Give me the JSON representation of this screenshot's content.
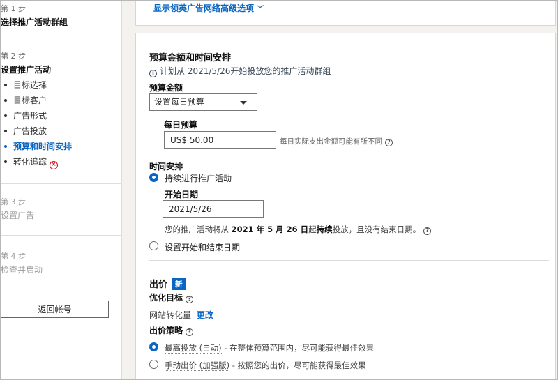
{
  "sidebar": {
    "step1": {
      "num": "第 1 步",
      "title": "选择推广活动群组"
    },
    "step2": {
      "num": "第 2 步",
      "title": "设置推广活动",
      "items": [
        {
          "label": "目标选择"
        },
        {
          "label": "目标客户"
        },
        {
          "label": "广告形式"
        },
        {
          "label": "广告投放"
        },
        {
          "label": "预算和时间安排"
        },
        {
          "label": "转化追踪"
        }
      ]
    },
    "step3": {
      "num": "第 3 步",
      "title": "设置广告"
    },
    "step4": {
      "num": "第 4 步",
      "title": "检查并启动"
    },
    "back_button": "返回帐号"
  },
  "top_card": {
    "advanced_link": "显示领英广告网络高级选项"
  },
  "budget": {
    "section_title": "预算金额和时间安排",
    "info_text": "计划从 2021/5/26开始投放您的推广活动群组",
    "amount_label": "预算金额",
    "budget_type": "设置每日预算",
    "daily_label": "每日预算",
    "daily_value": "US$ 50.00",
    "daily_hint": "每日实际支出金额可能有所不同",
    "schedule_label": "时间安排",
    "option_continuous": "持续进行推广活动",
    "start_label": "开始日期",
    "start_value": "2021/5/26",
    "desc_prefix": "您的推广活动将从",
    "desc_date": "2021 年 5 月 26 日",
    "desc_mid": "起",
    "desc_bold": "持续",
    "desc_suffix": "投放，且没有结束日期。",
    "option_start_end": "设置开始和结束日期"
  },
  "bidding": {
    "title": "出价",
    "badge": "新",
    "goal_label": "优化目标",
    "goal_value": "网站转化量",
    "goal_change": "更改",
    "strategy_label": "出价策略",
    "option_max_name": "最高投放 (自动)",
    "option_max_desc": " - 在整体预算范围内，尽可能获得最佳效果",
    "option_manual_name": "手动出价 (加强版)",
    "option_manual_desc": " - 按照您的出价，尽可能获得最佳效果"
  },
  "colors": {
    "accent": "#0a66c2",
    "error": "#cc1016"
  }
}
